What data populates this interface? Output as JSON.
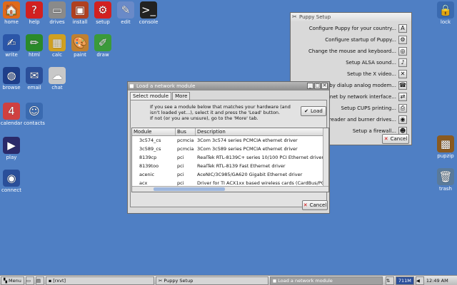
{
  "desktop_icons": [
    {
      "label": "home",
      "glyph": "🏠",
      "color": "#e06a1a",
      "icon": "home-icon"
    },
    {
      "label": "help",
      "glyph": "?",
      "color": "#d22020",
      "icon": "help-icon"
    },
    {
      "label": "drives",
      "glyph": "▭",
      "color": "#8a8a8a",
      "icon": "drives-icon"
    },
    {
      "label": "install",
      "glyph": "▣",
      "color": "#b04020",
      "icon": "install-icon"
    },
    {
      "label": "setup",
      "glyph": "⚙",
      "color": "#d22020",
      "icon": "setup-icon"
    },
    {
      "label": "edit",
      "glyph": "✎",
      "color": "#6a8ac8",
      "icon": "edit-icon"
    },
    {
      "label": "console",
      "glyph": ">_",
      "color": "#222222",
      "icon": "console-icon"
    },
    {
      "label": "write",
      "glyph": "✍",
      "color": "#2b56a8",
      "icon": "write-icon"
    },
    {
      "label": "html",
      "glyph": "✏",
      "color": "#2a8a2a",
      "icon": "html-icon"
    },
    {
      "label": "calc",
      "glyph": "▦",
      "color": "#d0a020",
      "icon": "calc-icon"
    },
    {
      "label": "paint",
      "glyph": "🎨",
      "color": "#c08030",
      "icon": "paint-icon"
    },
    {
      "label": "draw",
      "glyph": "✐",
      "color": "#3a9a3a",
      "icon": "draw-icon"
    },
    {
      "label": "browse",
      "glyph": "◍",
      "color": "#1f3f8a",
      "icon": "browse-icon"
    },
    {
      "label": "email",
      "glyph": "✉",
      "color": "#2b4f9a",
      "icon": "email-icon"
    },
    {
      "label": "chat",
      "glyph": "☁",
      "color": "#c8c8c8",
      "icon": "chat-icon"
    },
    {
      "label": "calendar",
      "glyph": "4",
      "color": "#d04040",
      "icon": "calendar-icon"
    },
    {
      "label": "contacts",
      "glyph": "☺",
      "color": "#3a6ab0",
      "icon": "contacts-icon"
    },
    {
      "label": "play",
      "glyph": "▶",
      "color": "#2a2a6a",
      "icon": "play-icon"
    },
    {
      "label": "connect",
      "glyph": "◉",
      "color": "#2a4f9a",
      "icon": "connect-icon"
    },
    {
      "label": "lock",
      "glyph": "🔒",
      "color": "#3a6ab0",
      "icon": "lock-icon"
    },
    {
      "label": "pupzip",
      "glyph": "▩",
      "color": "#8a5a20",
      "icon": "pupzip-icon"
    },
    {
      "label": "trash",
      "glyph": "🗑",
      "color": "#5a7a9a",
      "icon": "trash-icon"
    }
  ],
  "puppy_setup": {
    "title": "Puppy Setup",
    "rows": [
      {
        "label": "Configure Puppy for your country...",
        "glyph": "A"
      },
      {
        "label": "Configure startup of Puppy...",
        "glyph": "⚙"
      },
      {
        "label": "Change the mouse and keyboard...",
        "glyph": "◎"
      },
      {
        "label": "Setup ALSA sound...",
        "glyph": "♪"
      },
      {
        "label": "Setup the X video...",
        "glyph": "✕"
      },
      {
        "label": "et by dialup analog modem...",
        "glyph": "☎"
      },
      {
        "label": "ernet by network interface...",
        "glyph": "⇄"
      },
      {
        "label": "Setup CUPS printing...",
        "glyph": "⎙"
      },
      {
        "label": "D reader and burner drives...",
        "glyph": "◉"
      },
      {
        "label": "Setup a firewall...",
        "glyph": "☻"
      }
    ],
    "cancel_label": "Cancel"
  },
  "network_dialog": {
    "title": "Load a network module",
    "tabs": [
      "Select module",
      "More"
    ],
    "instructions_1": "If you see a module below that matches your hardware (and",
    "instructions_2": "isn't loaded yet...), select it and press the 'Load' button.",
    "instructions_3": "If not (or you are unsure), go to the 'More' tab.",
    "load_label": "Load",
    "columns": [
      "Module",
      "Bus",
      "Description"
    ],
    "rows": [
      {
        "module": "3c574_cs",
        "bus": "pcmcia",
        "desc": "3Com 3c574 series PCMCIA ethernet driver"
      },
      {
        "module": "3c589_cs",
        "bus": "pcmcia",
        "desc": "3Com 3c589 series PCMCIA ethernet driver"
      },
      {
        "module": "8139cp",
        "bus": "pci",
        "desc": "RealTek RTL-8139C+ series 10/100 PCI Ethernet driver"
      },
      {
        "module": "8139too",
        "bus": "pci",
        "desc": "RealTek RTL-8139 Fast Ethernet driver"
      },
      {
        "module": "acenic",
        "bus": "pci",
        "desc": "AceNIC/3C985/GA620 Gigabit Ethernet driver"
      },
      {
        "module": "acx",
        "bus": "pci",
        "desc": "Driver for TI ACX1xx based wireless cards (CardBus/PC"
      }
    ],
    "cancel_label": "Cancel"
  },
  "taskbar": {
    "menu_label": "Menu",
    "items": [
      "[rxvt]",
      "Puppy Setup",
      "Load a network module"
    ],
    "mem_label": "711M",
    "clock": "12:49 AM"
  }
}
